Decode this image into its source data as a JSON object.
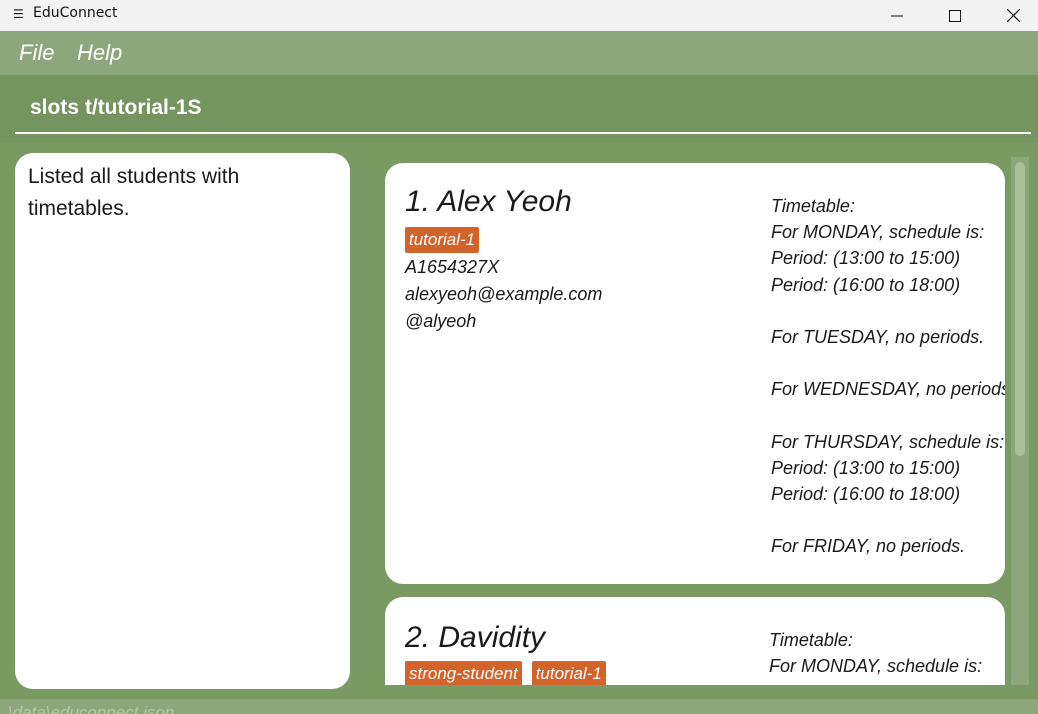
{
  "window": {
    "title": "EduConnect",
    "icon": "educonnect-app-icon"
  },
  "menu": {
    "file": "File",
    "help": "Help"
  },
  "command": {
    "text": "slots t/tutorial-1S"
  },
  "result": {
    "text": "Listed all students with timetables."
  },
  "students": [
    {
      "index_name": "1.  Alex Yeoh",
      "tags": [
        "tutorial-1"
      ],
      "student_id": "A1654327X",
      "email": "alexyeoh@example.com",
      "telegram": "@alyeoh",
      "timetable": [
        "Timetable:",
        "For MONDAY, schedule is:",
        "Period: (13:00 to 15:00)",
        "Period: (16:00 to 18:00)",
        "",
        "For TUESDAY, no periods.",
        "",
        "For WEDNESDAY, no periods.",
        "",
        "For THURSDAY, schedule is:",
        "Period: (13:00 to 15:00)",
        "Period: (16:00 to 18:00)",
        "",
        "For FRIDAY, no periods."
      ]
    },
    {
      "index_name": "2.  Davidity",
      "tags": [
        "strong-student",
        "tutorial-1"
      ],
      "timetable": [
        "Timetable:",
        "For MONDAY, schedule is:"
      ]
    }
  ],
  "status": {
    "text": "\\data\\educonnect.json"
  },
  "colors": {
    "background": "#7a9a64",
    "menubar": "#8ca77b",
    "command_area": "#749460",
    "tag": "#d2632a",
    "card": "#ffffff"
  }
}
